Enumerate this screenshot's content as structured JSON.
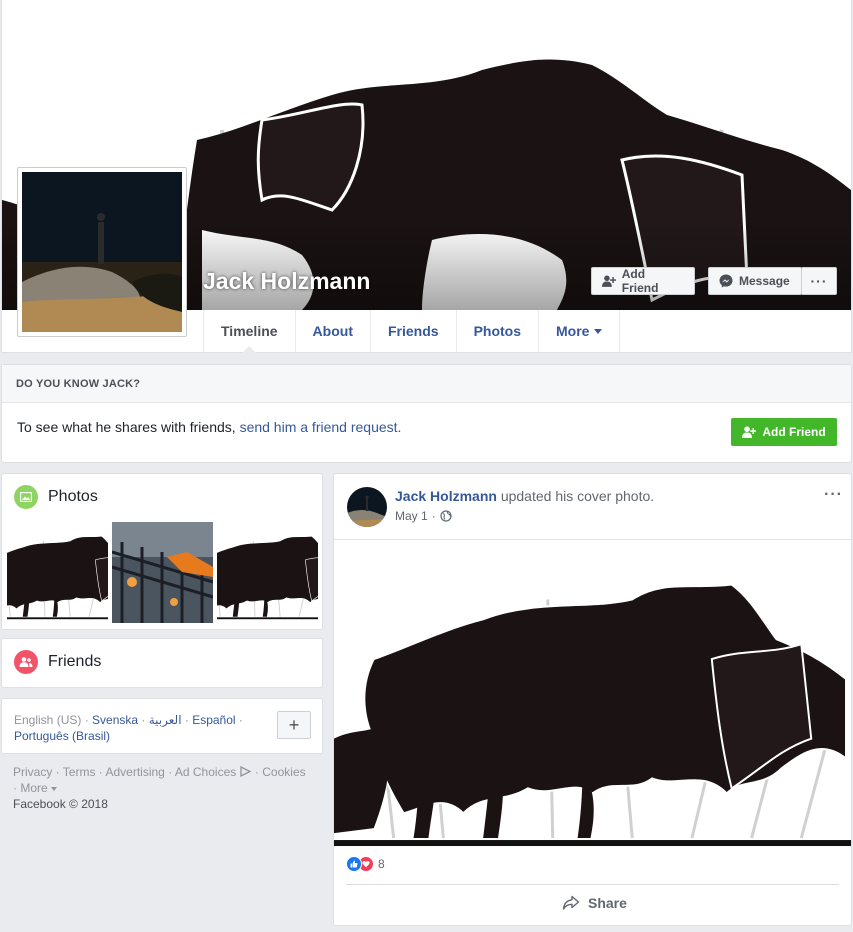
{
  "profile": {
    "name": "Jack Holzmann",
    "add_friend_label": "Add Friend",
    "message_label": "Message",
    "more_dots": "···"
  },
  "nav": {
    "tabs": [
      {
        "label": "Timeline",
        "active": true
      },
      {
        "label": "About"
      },
      {
        "label": "Friends"
      },
      {
        "label": "Photos"
      },
      {
        "label": "More"
      }
    ]
  },
  "know": {
    "heading": "DO YOU KNOW JACK?",
    "text": "To see what he shares with friends, ",
    "link": "send him a friend request.",
    "button_label": "Add Friend"
  },
  "photos": {
    "title": "Photos",
    "count": 3
  },
  "friends": {
    "title": "Friends"
  },
  "languages": {
    "current": "English (US)",
    "options": [
      "Svenska",
      "العربية",
      "Español",
      "Português (Brasil)"
    ],
    "plus": "+"
  },
  "footer": {
    "links": [
      "Privacy",
      "Terms",
      "Advertising",
      "Ad Choices",
      "Cookies",
      "More"
    ],
    "copyright": "Facebook © 2018"
  },
  "post": {
    "author": "Jack Holzmann",
    "action": " updated his cover photo.",
    "date": "May 1",
    "more": "···",
    "reactions_count": "8",
    "share_label": "Share"
  },
  "colors": {
    "link": "#365899",
    "green": "#42b72a",
    "like_blue": "#1877f2",
    "love_red": "#f33e58",
    "photos_icon": "#8ed462",
    "friends_icon": "#f35369"
  }
}
